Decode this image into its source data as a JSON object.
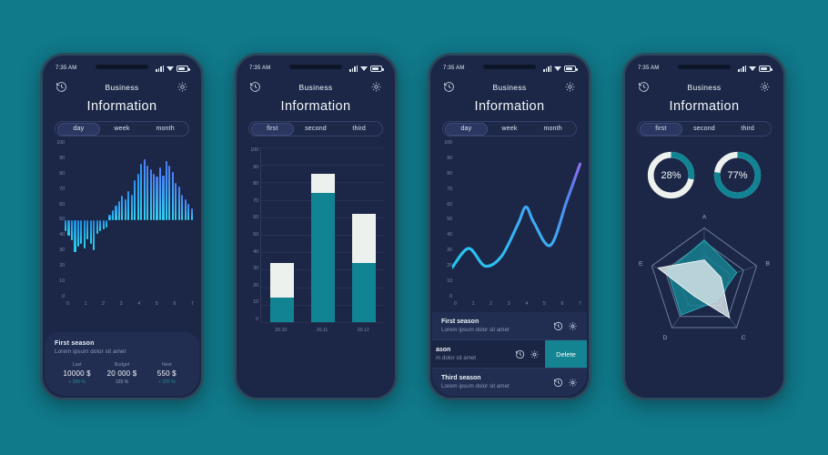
{
  "background_color": "#10798a",
  "statusbar": {
    "time": "7:35 AM",
    "icons": [
      "signal-icon",
      "wifi-icon",
      "battery-icon"
    ]
  },
  "nav": {
    "title": "Business",
    "back_icon": "history-clock-icon",
    "settings_icon": "gear-icon"
  },
  "page_title": "Information",
  "colors": {
    "teal": "#118494",
    "cyan": "#23c9f0",
    "blue": "#4a7cf5",
    "violet": "#8a6ff0",
    "card": "#222e51",
    "screen": "#1c2747"
  },
  "phone1": {
    "segments": [
      {
        "label": "day",
        "active": true
      },
      {
        "label": "week",
        "active": false
      },
      {
        "label": "month",
        "active": false
      }
    ],
    "footer": {
      "title": "First season",
      "subtitle": "Lorem ipsum dolor sit amet",
      "stats": [
        {
          "label": "Last",
          "value": "10000 $",
          "pct": "+ 300 %"
        },
        {
          "label": "Budget",
          "value": "20 000 $",
          "pct": "125 %"
        },
        {
          "label": "Next",
          "value": "550 $",
          "pct": "+ 220 %"
        }
      ]
    },
    "chart_data": {
      "type": "bar",
      "title": "Information",
      "xlabel": "",
      "ylabel": "",
      "ylim": [
        0,
        100
      ],
      "yticks": [
        100,
        90,
        80,
        70,
        60,
        50,
        40,
        30,
        20,
        10,
        0
      ],
      "xticks": [
        "0",
        "1",
        "2",
        "3",
        "4",
        "5",
        "6",
        "7"
      ],
      "baseline": 50,
      "grid": false,
      "note": "Diverging bars around a 50 baseline; negative-side bars drop below 50, positive-side bars rise above it.",
      "values": [
        43,
        40,
        37,
        30,
        33,
        35,
        32,
        38,
        35,
        31,
        41,
        43,
        44,
        45,
        53,
        56,
        59,
        62,
        65,
        63,
        68,
        66,
        75,
        79,
        85,
        88,
        84,
        82,
        79,
        77,
        83,
        78,
        87,
        84,
        80,
        73,
        71,
        66,
        63,
        60,
        57
      ]
    }
  },
  "phone2": {
    "segments": [
      {
        "label": "first",
        "active": true
      },
      {
        "label": "second",
        "active": false
      },
      {
        "label": "third",
        "active": false
      }
    ],
    "chart_data": {
      "type": "bar",
      "title": "Information",
      "stacked": true,
      "xlabel": "",
      "ylabel": "",
      "ylim": [
        0,
        100
      ],
      "yticks": [
        100,
        90,
        80,
        70,
        60,
        50,
        40,
        30,
        20,
        10,
        0
      ],
      "categories": [
        "20.10",
        "20.11",
        "20.12"
      ],
      "grid": true,
      "series": [
        {
          "name": "filled-teal",
          "color": "#118494",
          "values": [
            14,
            74,
            34
          ]
        },
        {
          "name": "remainder-white",
          "color": "#edf1ee",
          "values": [
            20,
            11,
            28
          ]
        }
      ],
      "totals": [
        34,
        85,
        62
      ]
    }
  },
  "phone3": {
    "segments": [
      {
        "label": "day",
        "active": true
      },
      {
        "label": "week",
        "active": false
      },
      {
        "label": "month",
        "active": false
      }
    ],
    "chart_data": {
      "type": "line",
      "title": "Information",
      "xlabel": "",
      "ylabel": "",
      "ylim": [
        0,
        100
      ],
      "yticks": [
        100,
        90,
        80,
        70,
        60,
        50,
        40,
        30,
        20,
        10,
        0
      ],
      "xticks": [
        "0",
        "1",
        "2",
        "3",
        "4",
        "5",
        "6",
        "7"
      ],
      "grid": false,
      "series": [
        {
          "name": "trend",
          "gradient": [
            "#23c9f0",
            "#4a7cf5",
            "#8a6ff0"
          ],
          "x": [
            0,
            1,
            2,
            3,
            4,
            4.5,
            5,
            6,
            7,
            7.8
          ],
          "values": [
            20,
            32,
            21,
            27,
            47,
            58,
            48,
            34,
            62,
            85
          ]
        }
      ]
    },
    "list": [
      {
        "title": "First season",
        "subtitle": "Lorem ipsum dolor sit amet",
        "icons": [
          "history-clock-icon",
          "gear-icon"
        ],
        "swiped": false
      },
      {
        "title": "ason",
        "subtitle": "m dolor sit amet",
        "icons": [
          "history-clock-icon",
          "gear-icon"
        ],
        "swiped": true,
        "action_label": "Delete"
      },
      {
        "title": "Third season",
        "subtitle": "Lorem ipsum dolor sit amet",
        "icons": [
          "history-clock-icon",
          "gear-icon"
        ],
        "swiped": false
      }
    ]
  },
  "phone4": {
    "segments": [
      {
        "label": "first",
        "active": true
      },
      {
        "label": "second",
        "active": false
      },
      {
        "label": "third",
        "active": false
      }
    ],
    "chart_data": [
      {
        "type": "pie",
        "subtype": "donut",
        "title": "",
        "label": "28%",
        "value": 28,
        "track_color": "#edf1ee",
        "fill_color": "#118494"
      },
      {
        "type": "pie",
        "subtype": "donut",
        "title": "",
        "label": "77%",
        "value": 77,
        "track_color": "#edf1ee",
        "fill_color": "#118494"
      },
      {
        "type": "radar",
        "title": "",
        "categories": [
          "A",
          "B",
          "C",
          "D",
          "E"
        ],
        "rmax": 100,
        "grid": true,
        "series": [
          {
            "name": "teal-series",
            "color": "#16808f",
            "values": [
              78,
              62,
              40,
              72,
              70
            ]
          },
          {
            "name": "light-series",
            "color": "#dbe8ec",
            "values": [
              42,
              32,
              78,
              30,
              88
            ]
          }
        ]
      }
    ]
  }
}
